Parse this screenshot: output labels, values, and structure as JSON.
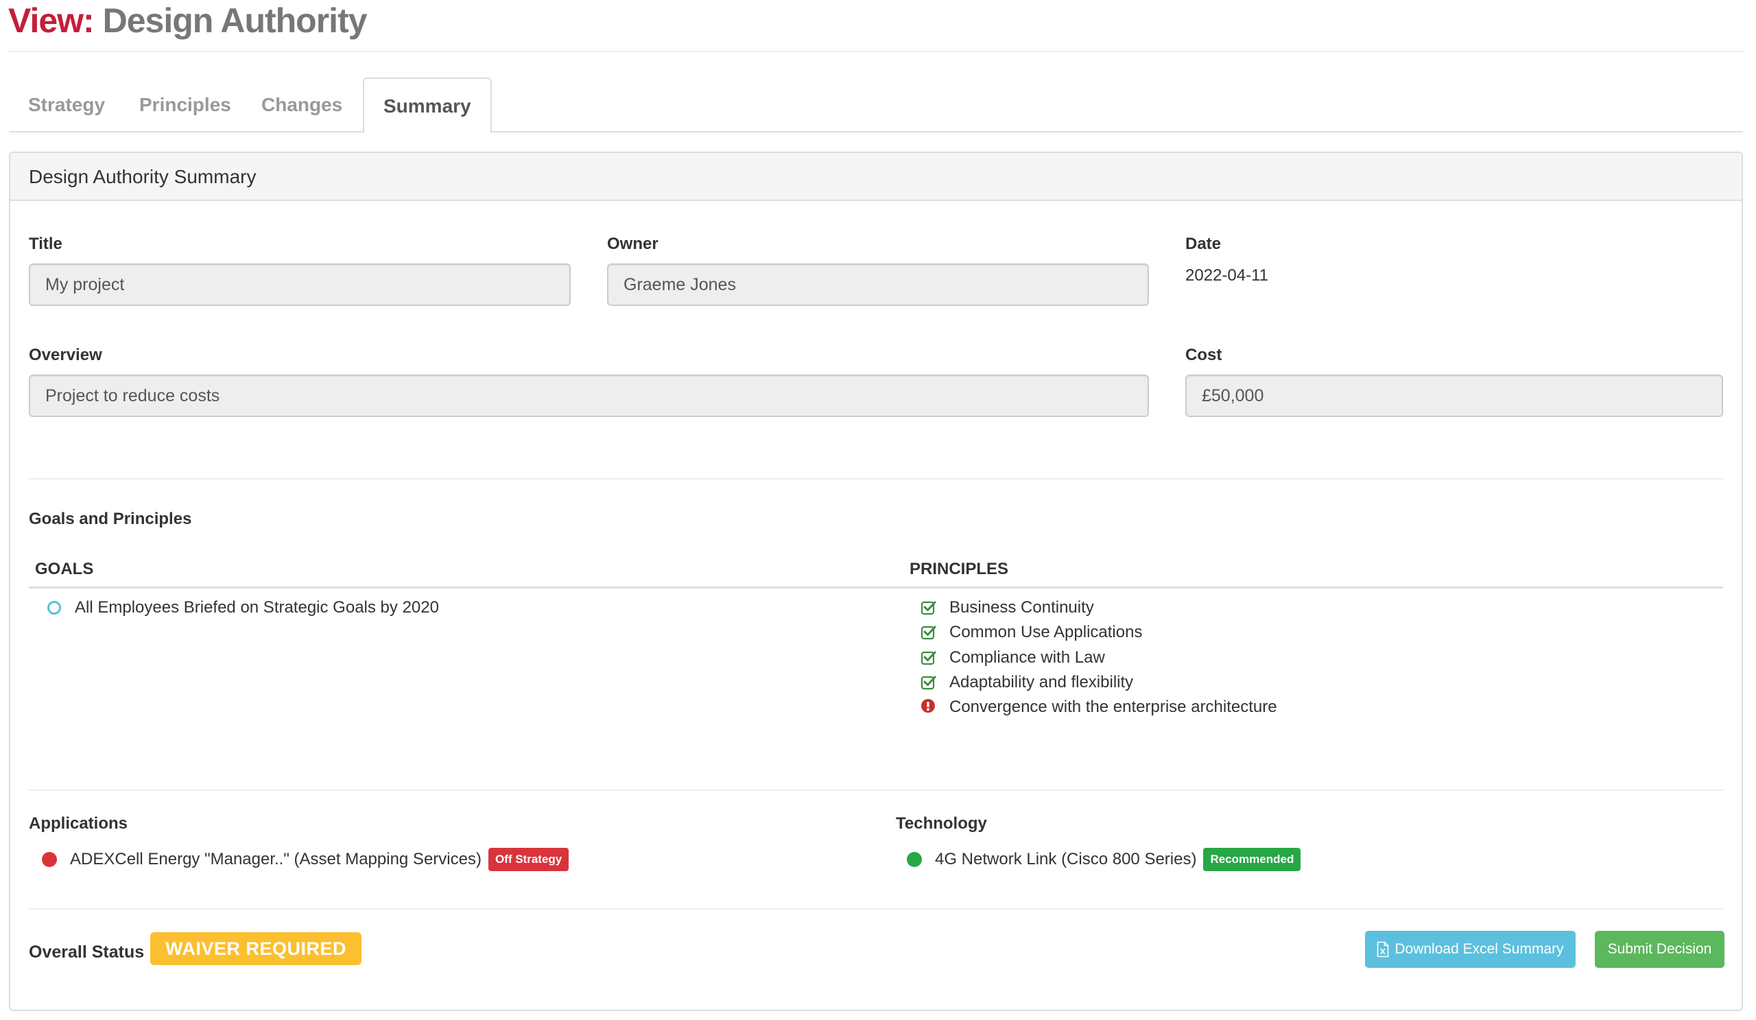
{
  "header": {
    "prefix": "View:",
    "title": "Design Authority"
  },
  "tabs": [
    {
      "label": "Strategy",
      "active": false
    },
    {
      "label": "Principles",
      "active": false
    },
    {
      "label": "Changes",
      "active": false
    },
    {
      "label": "Summary",
      "active": true
    }
  ],
  "panel": {
    "title": "Design Authority Summary",
    "fields": {
      "title": {
        "label": "Title",
        "value": "My project"
      },
      "owner": {
        "label": "Owner",
        "value": "Graeme Jones"
      },
      "date": {
        "label": "Date",
        "value": "2022-04-11"
      },
      "overview": {
        "label": "Overview",
        "value": "Project to reduce costs"
      },
      "cost": {
        "label": "Cost",
        "value": "£50,000"
      }
    },
    "goals_principles": {
      "section_title": "Goals and Principles",
      "goals_header": "GOALS",
      "principles_header": "PRINCIPLES",
      "goals": [
        {
          "label": "All Employees Briefed on Strategic Goals by 2020",
          "icon": "circle-outline-icon"
        }
      ],
      "principles": [
        {
          "label": "Business Continuity",
          "icon": "check-square-icon",
          "status": "compliant"
        },
        {
          "label": "Common Use Applications",
          "icon": "check-square-icon",
          "status": "compliant"
        },
        {
          "label": "Compliance with Law",
          "icon": "check-square-icon",
          "status": "compliant"
        },
        {
          "label": "Adaptability and flexibility",
          "icon": "check-square-icon",
          "status": "compliant"
        },
        {
          "label": "Convergence with the enterprise architecture",
          "icon": "exclamation-circle-icon",
          "status": "non-compliant"
        }
      ]
    },
    "applications": {
      "title": "Applications",
      "items": [
        {
          "label": "ADEXCell Energy \"Manager..\" (Asset Mapping Services)",
          "badge": "Off Strategy",
          "status_color": "#d9343b"
        }
      ]
    },
    "technology": {
      "title": "Technology",
      "items": [
        {
          "label": "4G Network Link (Cisco 800 Series)",
          "badge": "Recommended",
          "status_color": "#28a745"
        }
      ]
    },
    "overall_status": {
      "label": "Overall Status",
      "value": "WAIVER REQUIRED",
      "color": "#fbbf2f"
    },
    "actions": {
      "download_label": "Download Excel Summary",
      "submit_label": "Submit Decision"
    }
  },
  "colors": {
    "brand_red": "#c41e3a",
    "info": "#5bc0de",
    "success": "#5cb85c",
    "danger": "#d9343b",
    "check_green": "#3c8d40",
    "warning": "#fbbf2f"
  }
}
